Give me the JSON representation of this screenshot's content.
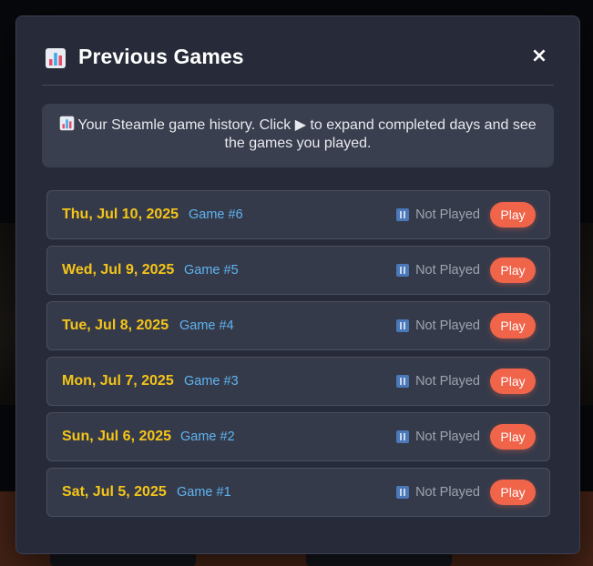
{
  "modal": {
    "title": "Previous Games",
    "header_icon": "bar-chart-icon",
    "close_label": "×",
    "info_text": "Your Steamle game history. Click ▶ to expand completed days and see the games you played.",
    "info_icon": "bar-chart-icon"
  },
  "games": [
    {
      "date": "Thu, Jul 10, 2025",
      "game": "Game #6",
      "status": "Not Played",
      "status_icon": "pause-icon",
      "play_label": "Play"
    },
    {
      "date": "Wed, Jul 9, 2025",
      "game": "Game #5",
      "status": "Not Played",
      "status_icon": "pause-icon",
      "play_label": "Play"
    },
    {
      "date": "Tue, Jul 8, 2025",
      "game": "Game #4",
      "status": "Not Played",
      "status_icon": "pause-icon",
      "play_label": "Play"
    },
    {
      "date": "Mon, Jul 7, 2025",
      "game": "Game #3",
      "status": "Not Played",
      "status_icon": "pause-icon",
      "play_label": "Play"
    },
    {
      "date": "Sun, Jul 6, 2025",
      "game": "Game #2",
      "status": "Not Played",
      "status_icon": "pause-icon",
      "play_label": "Play"
    },
    {
      "date": "Sat, Jul 5, 2025",
      "game": "Game #1",
      "status": "Not Played",
      "status_icon": "pause-icon",
      "play_label": "Play"
    }
  ],
  "colors": {
    "modal_bg": "#272b39",
    "date_text": "#f5c518",
    "game_number": "#5fb4f0",
    "play_button": "#f0644a",
    "status_text": "#9ea3b0"
  }
}
